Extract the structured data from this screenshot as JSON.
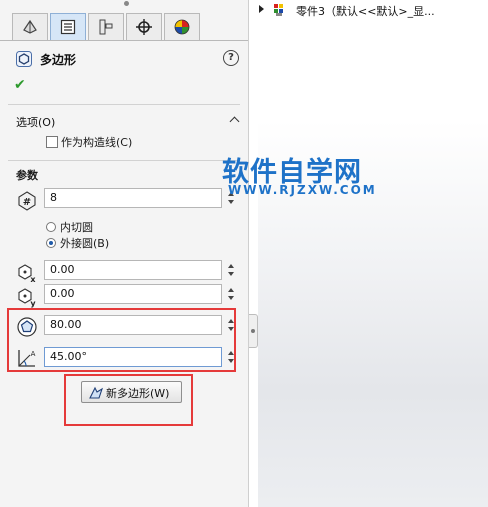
{
  "panel": {
    "feature_title": "多边形",
    "help_glyph": "?",
    "ok_glyph": "✔",
    "options": {
      "header": "选项(O)",
      "construction_label": "作为构造线(C)",
      "construction_checked": false
    },
    "params": {
      "header": "参数",
      "sides": "8",
      "inscribed_label": "内切圆",
      "circumscribed_label": "外接圆(B)",
      "selected": "circumscribed",
      "center_x": "0.00",
      "center_y": "0.00",
      "diameter": "80.00",
      "angle": "45.00°"
    },
    "new_polygon_button": "新多边形(W)"
  },
  "tree": {
    "item_label": "零件3（默认<<默认>_显..."
  },
  "watermark": {
    "title": "软件自学网",
    "url": "WWW.RJZXW.COM"
  },
  "colors": {
    "highlight_red": "#e53a3a",
    "watermark_blue": "#1e72c8",
    "check_green": "#2d9a2d"
  },
  "icons": {
    "tabs": [
      "feature-manager-icon",
      "property-manager-icon",
      "configuration-manager-icon",
      "dimxpert-icon",
      "display-manager-icon"
    ]
  }
}
